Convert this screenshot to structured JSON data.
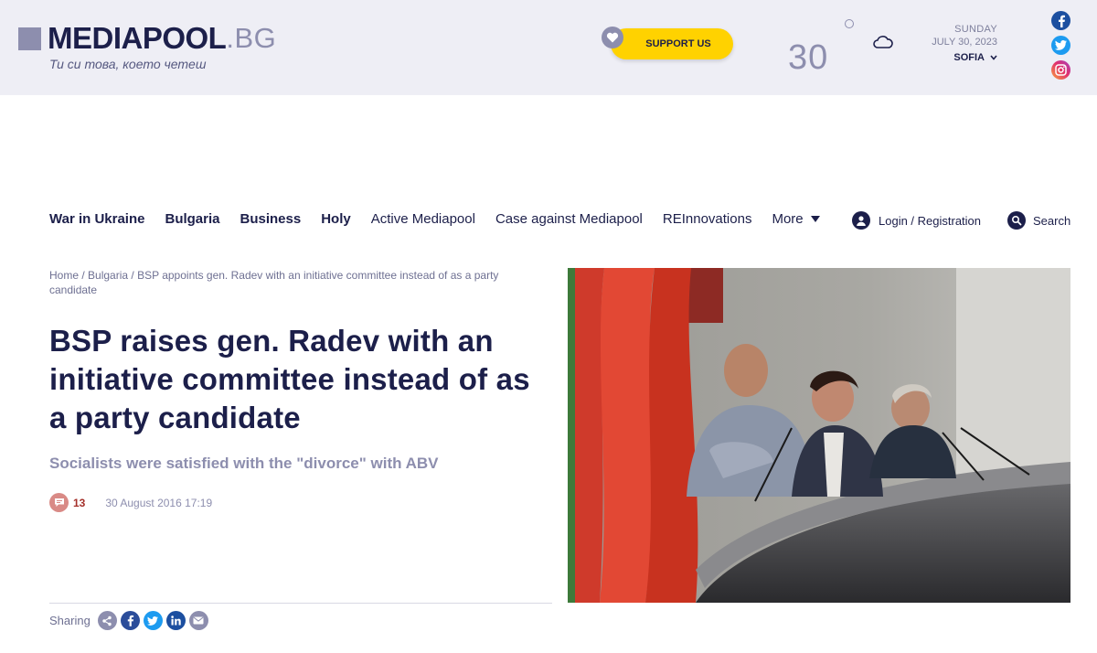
{
  "header": {
    "logo_name": "MEDIAPOOL",
    "logo_tld": ".BG",
    "tagline": "Ти си това, което четеш",
    "support_label": "SUPPORT US"
  },
  "weather": {
    "temperature": "30",
    "day": "SUNDAY",
    "date": "JULY 30, 2023",
    "city": "SOFIA"
  },
  "social_icons": [
    "facebook-icon",
    "twitter-icon",
    "instagram-icon"
  ],
  "nav": {
    "items": [
      {
        "label": "War in Ukraine"
      },
      {
        "label": "Bulgaria"
      },
      {
        "label": "Business"
      },
      {
        "label": "Holy"
      },
      {
        "label": "Active Mediapool"
      },
      {
        "label": "Case against Mediapool"
      },
      {
        "label": "REInnovations"
      }
    ],
    "more_label": "More",
    "login_label": "Login / Registration",
    "search_label": "Search"
  },
  "article": {
    "breadcrumb": {
      "home": "Home",
      "section": "Bulgaria",
      "current": "BSP appoints gen. Radev with an initiative committee instead of as a party candidate"
    },
    "headline": "BSP raises gen. Radev with an initiative committee instead of as a party candidate",
    "subtitle": "Socialists were satisfied with the \"divorce\" with ABV",
    "comment_count": "13",
    "published": "30 August 2016 17:19",
    "sharing_label": "Sharing"
  },
  "colors": {
    "brand_navy": "#1c1f4a",
    "brand_grey": "#8d8eae",
    "header_bg": "#eeeef5",
    "support_yellow": "#ffd200",
    "comment_red": "#a4302a"
  }
}
